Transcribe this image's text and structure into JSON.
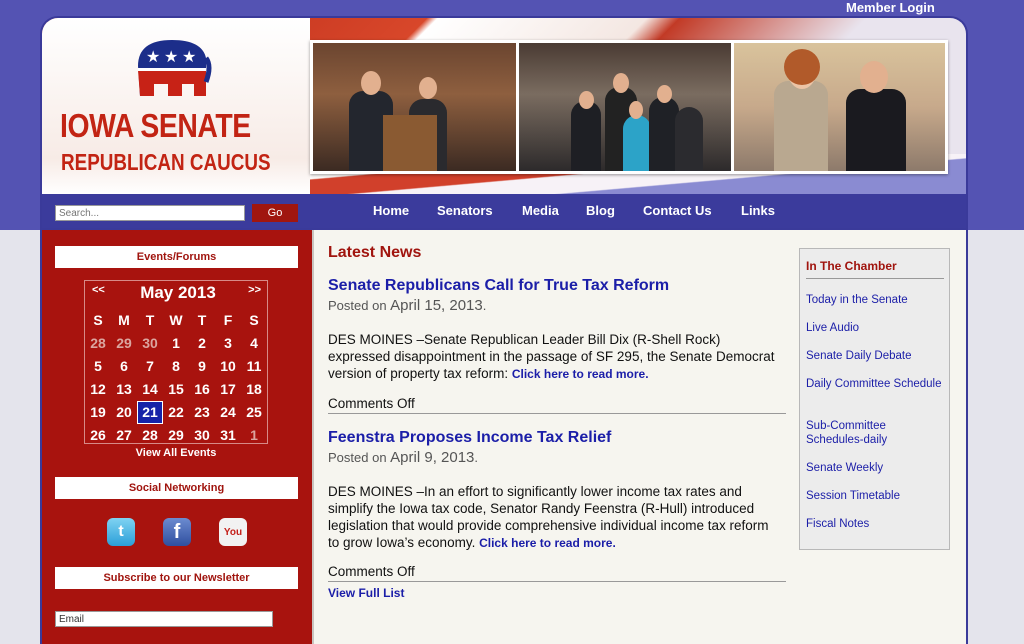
{
  "header": {
    "member_login": "Member Login",
    "logo_title": "IOWA SENATE",
    "logo_subtitle": "REPUBLICAN CAUCUS"
  },
  "search": {
    "placeholder": "Search...",
    "button": "Go"
  },
  "nav": {
    "items": [
      "Home",
      "Senators",
      "Media",
      "Blog",
      "Contact Us",
      "Links"
    ]
  },
  "sidebar": {
    "events_heading": "Events/Forums",
    "calendar": {
      "prev": "<<",
      "next": ">>",
      "month": "May 2013",
      "weekdays": [
        "S",
        "M",
        "T",
        "W",
        "T",
        "F",
        "S"
      ],
      "days": [
        {
          "d": "28",
          "other": true
        },
        {
          "d": "29",
          "other": true
        },
        {
          "d": "30",
          "other": true
        },
        {
          "d": "1"
        },
        {
          "d": "2"
        },
        {
          "d": "3"
        },
        {
          "d": "4"
        },
        {
          "d": "5"
        },
        {
          "d": "6"
        },
        {
          "d": "7"
        },
        {
          "d": "8"
        },
        {
          "d": "9"
        },
        {
          "d": "10"
        },
        {
          "d": "11"
        },
        {
          "d": "12"
        },
        {
          "d": "13"
        },
        {
          "d": "14"
        },
        {
          "d": "15"
        },
        {
          "d": "16"
        },
        {
          "d": "17"
        },
        {
          "d": "18"
        },
        {
          "d": "19"
        },
        {
          "d": "20"
        },
        {
          "d": "21",
          "today": true
        },
        {
          "d": "22"
        },
        {
          "d": "23"
        },
        {
          "d": "24"
        },
        {
          "d": "25"
        },
        {
          "d": "26"
        },
        {
          "d": "27"
        },
        {
          "d": "28"
        },
        {
          "d": "29"
        },
        {
          "d": "30"
        },
        {
          "d": "31"
        },
        {
          "d": "1",
          "other": true
        }
      ]
    },
    "view_all": "View All Events",
    "social_heading": "Social Networking",
    "social": [
      "twitter-icon",
      "facebook-icon",
      "youtube-icon"
    ],
    "newsletter_heading": "Subscribe to our Newsletter",
    "email_value": "Email"
  },
  "main": {
    "heading": "Latest News",
    "posts": [
      {
        "title": "Senate Republicans Call for True Tax Reform",
        "posted_prefix": "Posted on",
        "date": "April 15, 2013",
        "body": "DES MOINES –Senate Republican Leader Bill Dix (R-Shell Rock) expressed disappointment in the passage of SF 295, the Senate Democrat version of property tax reform:",
        "more": "Click here to read more.",
        "comments": "Comments Off"
      },
      {
        "title": "Feenstra Proposes Income Tax Relief",
        "posted_prefix": "Posted on",
        "date": "April 9, 2013",
        "body": "DES MOINES –In an effort to significantly lower income tax rates and simplify the Iowa tax code, Senator Randy Feenstra (R-Hull) introduced legislation that would provide comprehensive individual income tax reform to grow Iowa’s economy.",
        "more": "Click here to read more.",
        "comments": "Comments Off"
      }
    ],
    "view_full": "View Full List"
  },
  "chamber": {
    "heading": "In The Chamber",
    "links": [
      "Today in the Senate",
      "Live Audio",
      "Senate Daily Debate",
      "Daily Committee Schedule",
      "Sub-Committee Schedules-daily",
      "Senate Weekly",
      "Session Timetable",
      "Fiscal Notes"
    ]
  },
  "colors": {
    "brand_red": "#a8130e",
    "brand_blue": "#3b3b9c",
    "link_blue": "#1b1ea8"
  }
}
